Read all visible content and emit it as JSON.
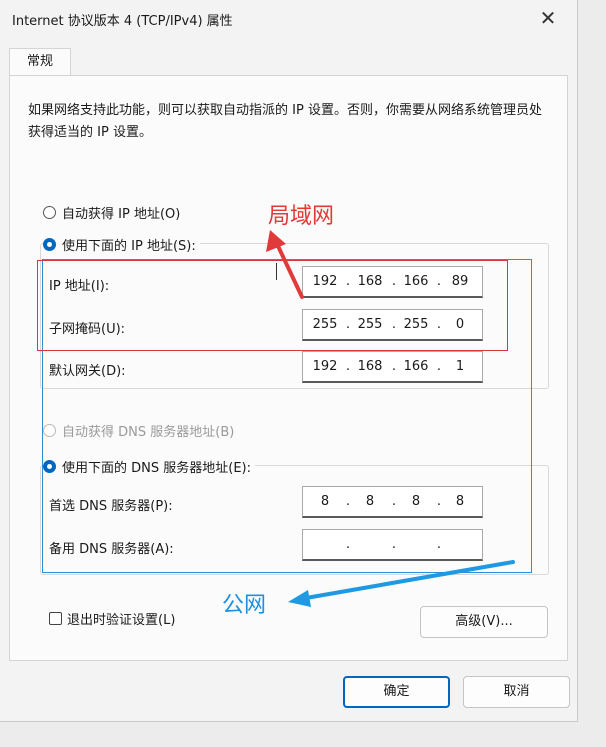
{
  "window": {
    "title": "Internet 协议版本 4 (TCP/IPv4) 属性",
    "close_glyph": "✕"
  },
  "tab": {
    "label": "常规"
  },
  "description": "如果网络支持此功能，则可以获取自动指派的 IP 设置。否则，你需要从网络系统管理员处获得适当的 IP 设置。",
  "ip_section": {
    "auto_label": "自动获得 IP 地址(O)",
    "manual_label": "使用下面的 IP 地址(S):",
    "manual_selected": true,
    "fields": [
      {
        "label": "IP 地址(I):",
        "octets": [
          "192",
          "168",
          "166",
          "89"
        ]
      },
      {
        "label": "子网掩码(U):",
        "octets": [
          "255",
          "255",
          "255",
          "0"
        ]
      },
      {
        "label": "默认网关(D):",
        "octets": [
          "192",
          "168",
          "166",
          "1"
        ]
      }
    ]
  },
  "dns_section": {
    "auto_label": "自动获得 DNS 服务器地址(B)",
    "manual_label": "使用下面的 DNS 服务器地址(E):",
    "manual_selected": true,
    "fields": [
      {
        "label": "首选 DNS 服务器(P):",
        "octets": [
          "8",
          "8",
          "8",
          "8"
        ]
      },
      {
        "label": "备用 DNS 服务器(A):",
        "octets": [
          "",
          "",
          "",
          ""
        ]
      }
    ]
  },
  "validate_checkbox": {
    "label": "退出时验证设置(L)",
    "checked": false
  },
  "buttons": {
    "advanced": "高级(V)...",
    "ok": "确定",
    "cancel": "取消"
  },
  "annotations": {
    "lan_label": "局域网",
    "wan_label": "公网",
    "lan_color": "#e03a3a",
    "wan_color": "#1f8fe0"
  },
  "colors": {
    "accent": "#0067c0"
  }
}
